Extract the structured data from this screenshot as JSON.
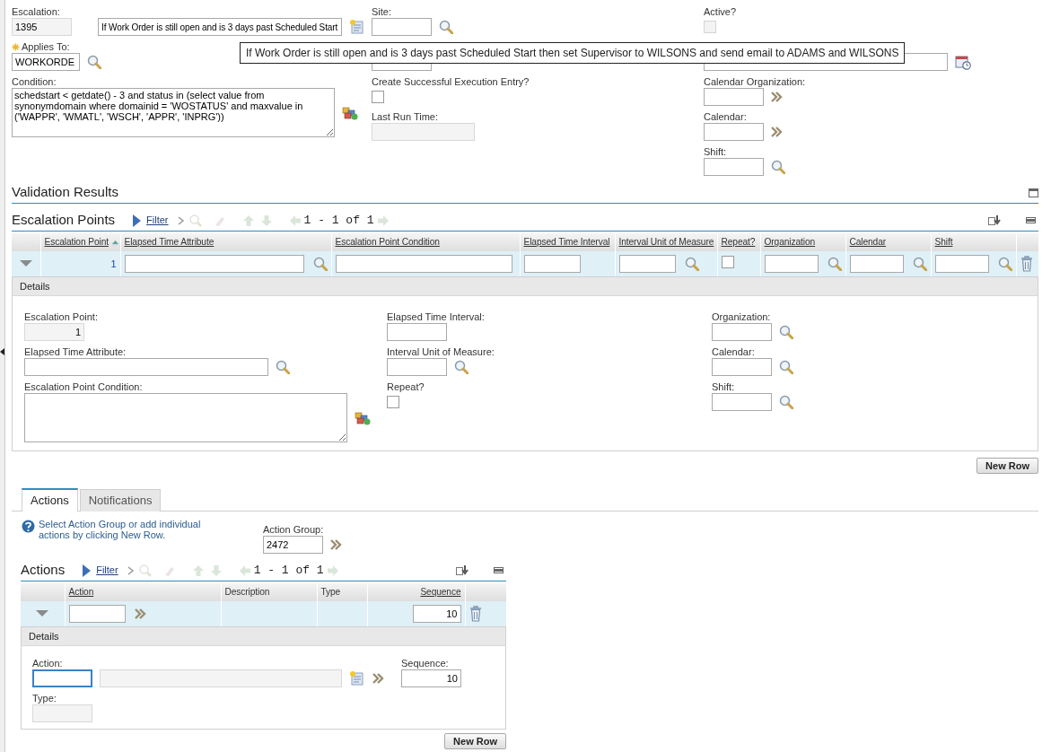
{
  "header": {
    "columns": [
      [
        {
          "label": "Escalation:",
          "kind": "readonly",
          "value": "1395",
          "beside": {
            "kind": "long_text",
            "value": "If Work Order is still open and is 3 days past Scheduled Start",
            "button": {
              "kind": "detail"
            }
          }
        },
        {
          "label": "Applies To:",
          "required": true,
          "kind": "text",
          "value": "WORKORDE",
          "button": {
            "kind": "lookup"
          }
        },
        {
          "label": "Condition:",
          "kind": "textarea",
          "value": "schedstart < getdate() - 3 and status in (select value from synonymdomain where domainid = 'WOSTATUS' and maxvalue in ('WAPPR', 'WMATL', 'WSCH', 'APPR', 'INPRG'))",
          "button": {
            "kind": "expression"
          }
        }
      ],
      [
        {
          "label": "Site:",
          "kind": "text",
          "button": {
            "kind": "lookup"
          }
        },
        {
          "kind": "text"
        },
        {
          "label": "Create Successful Execution Entry?",
          "kind": "checkbox",
          "checked": false,
          "disabled": false
        },
        {
          "label": "Last Run Time:",
          "kind": "medium_readonly"
        }
      ],
      [
        {
          "label": "Active?",
          "kind": "checkbox",
          "checked": false,
          "disabled": true
        },
        {
          "kind": "long_text",
          "button": {
            "kind": "calendar"
          }
        },
        {
          "label": "Calendar Organization:",
          "kind": "text",
          "button": {
            "kind": "menu"
          }
        },
        {
          "label": "Calendar:",
          "kind": "text",
          "button": {
            "kind": "menu"
          }
        },
        {
          "label": "Shift:",
          "kind": "text",
          "button": {
            "kind": "lookup"
          }
        }
      ]
    ]
  },
  "tooltip": "If Work Order is still open and is 3 days past Scheduled Start then set Supervisor to WILSONS and send email to ADAMS and WILSONS",
  "validation_results": {
    "title": "Validation Results"
  },
  "escalation_points": {
    "title": "Escalation Points",
    "filter": "Filter",
    "pagination": "1 - 1 of 1",
    "columns": [
      {
        "label": "Escalation Point",
        "sortable": true,
        "sorted": true
      },
      {
        "label": "Elapsed Time Attribute",
        "sortable": true,
        "sorted": false
      },
      {
        "label": "Escalation Point Condition",
        "sortable": true,
        "sorted": false
      },
      {
        "label": "Elapsed Time Interval",
        "sortable": true,
        "sorted": false
      },
      {
        "label": "Interval Unit of Measure",
        "sortable": true,
        "sorted": false
      },
      {
        "label": "Repeat?",
        "sortable": true,
        "sorted": false
      },
      {
        "label": "Organization",
        "sortable": true,
        "sorted": false
      },
      {
        "label": "Calendar",
        "sortable": true,
        "sorted": false
      },
      {
        "label": "Shift",
        "sortable": true,
        "sorted": false
      }
    ],
    "rows": [
      {
        "expanded": true,
        "cells": [
          {
            "kind": "number",
            "value": "1"
          },
          {
            "kind": "long_field",
            "button": {
              "kind": "lookup"
            }
          },
          {
            "kind": "long_field"
          },
          {
            "kind": "short_field"
          },
          {
            "kind": "short_field",
            "button": {
              "kind": "lookup"
            }
          },
          {
            "kind": "checkbox",
            "checked": false
          },
          {
            "kind": "short_field",
            "button": {
              "kind": "lookup"
            }
          },
          {
            "kind": "short_field",
            "button": {
              "kind": "lookup"
            }
          },
          {
            "kind": "short_field",
            "button": {
              "kind": "lookup"
            }
          }
        ]
      }
    ],
    "details_title": "Details",
    "details": [
      [
        {
          "label": "Escalation Point:",
          "kind": "number_readonly",
          "value": "1"
        },
        {
          "label": "Elapsed Time Attribute:",
          "kind": "long_text",
          "button": {
            "kind": "lookup"
          }
        },
        {
          "label": "Escalation Point Condition:",
          "kind": "textarea",
          "button": {
            "kind": "expression"
          }
        }
      ],
      [
        {
          "label": "Elapsed Time Interval:",
          "kind": "text"
        },
        {
          "label": "Interval Unit of Measure:",
          "kind": "text",
          "button": {
            "kind": "lookup"
          }
        },
        {
          "label": "Repeat?",
          "kind": "checkbox",
          "checked": false,
          "disabled": false
        }
      ],
      [
        {
          "label": "Organization:",
          "kind": "text",
          "button": {
            "kind": "lookup"
          }
        },
        {
          "label": "Calendar:",
          "kind": "text",
          "button": {
            "kind": "lookup"
          }
        },
        {
          "label": "Shift:",
          "kind": "text",
          "button": {
            "kind": "lookup"
          }
        }
      ]
    ],
    "new_row": "New Row"
  },
  "tabs": [
    {
      "label": "Actions",
      "selected": true
    },
    {
      "label": "Notifications",
      "selected": false
    }
  ],
  "actions_tab": {
    "help": "Select Action Group or add individual actions by clicking New Row.",
    "action_group": {
      "label": "Action Group:",
      "kind": "text",
      "value": "2472",
      "button": {
        "kind": "menu"
      }
    },
    "actions": {
      "title": "Actions",
      "filter": "Filter",
      "pagination": "1 - 1 of 1",
      "columns": [
        {
          "label": "Action",
          "sortable": true,
          "sorted": false
        },
        {
          "label": "Description",
          "sortable": false,
          "sorted": false
        },
        {
          "label": "Type",
          "sortable": false,
          "sorted": false
        },
        {
          "label": "Sequence",
          "sortable": true,
          "sorted": false
        }
      ],
      "rows": [
        {
          "expanded": true,
          "cells": [
            {
              "kind": "short_field",
              "button": {
                "kind": "menu"
              }
            },
            {
              "kind": "empty"
            },
            {
              "kind": "empty"
            },
            {
              "kind": "number_field",
              "value": "10"
            }
          ]
        }
      ],
      "details_title": "Details",
      "details": [
        [
          {
            "label": "Action:",
            "kind": "text",
            "focused": true,
            "button": {
              "kind": "menu"
            },
            "beside": {
              "kind": "long_readonly",
              "button": {
                "kind": "detail"
              }
            }
          },
          {
            "label": "Type:",
            "kind": "readonly"
          }
        ],
        [
          {
            "label": "Sequence:",
            "kind": "number_text",
            "value": "10",
            "focused": false
          }
        ]
      ],
      "new_row": "New Row"
    }
  }
}
